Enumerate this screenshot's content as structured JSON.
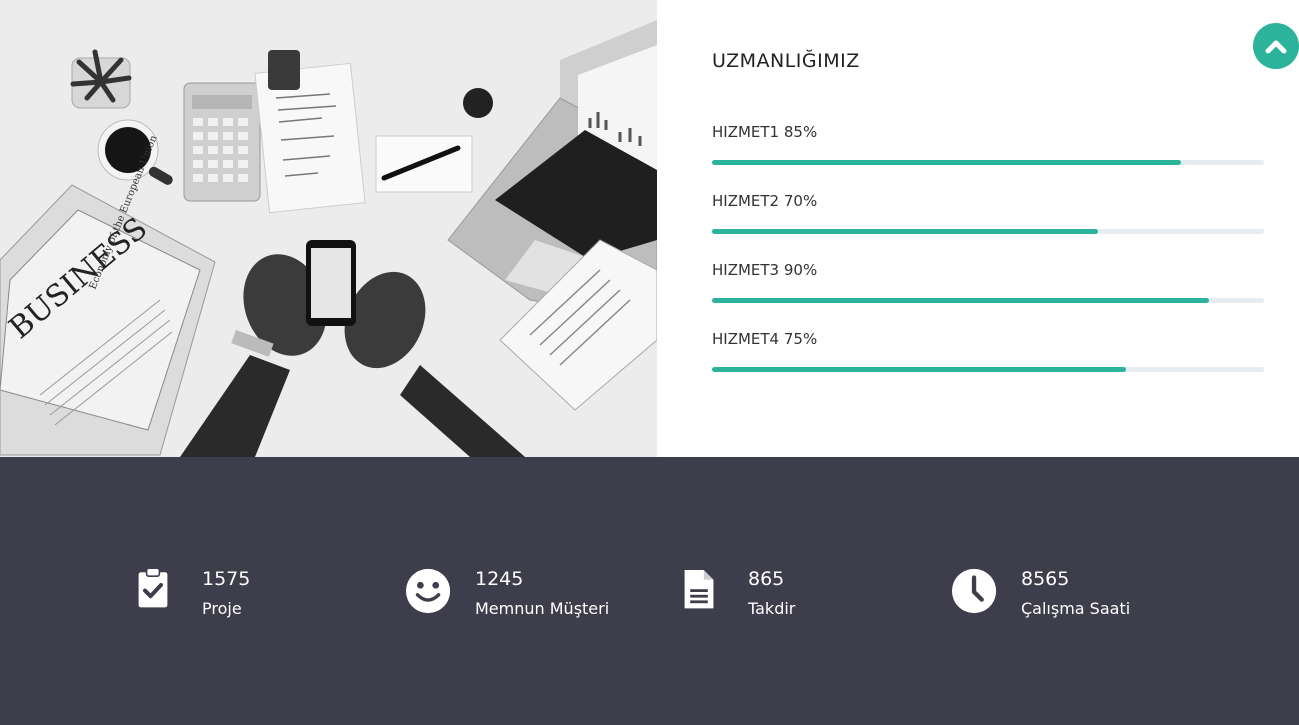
{
  "hero": {
    "newspaper_headline": "BUSINESS",
    "newspaper_subhead": "Economy of the European Union"
  },
  "skills": {
    "title": "UZMANLIĞIMIZ",
    "items": [
      {
        "label": "HIZMET1 85%",
        "percent": 85
      },
      {
        "label": "HIZMET2 70%",
        "percent": 70
      },
      {
        "label": "HIZMET3 90%",
        "percent": 90
      },
      {
        "label": "HIZMET4 75%",
        "percent": 75
      }
    ],
    "bar_color": "#2bb39b",
    "track_color": "#e6ecf0"
  },
  "scroll_top": {
    "icon": "chevron-up-icon",
    "color": "#2bb39b"
  },
  "stats": {
    "background": "#3d3d4b",
    "items": [
      {
        "icon": "clipboard-check-icon",
        "number": "1575",
        "label": "Proje"
      },
      {
        "icon": "smile-icon",
        "number": "1245",
        "label": "Memnun Müşteri"
      },
      {
        "icon": "document-icon",
        "number": "865",
        "label": "Takdir"
      },
      {
        "icon": "clock-icon",
        "number": "8565",
        "label": "Çalışma Saati"
      }
    ]
  }
}
